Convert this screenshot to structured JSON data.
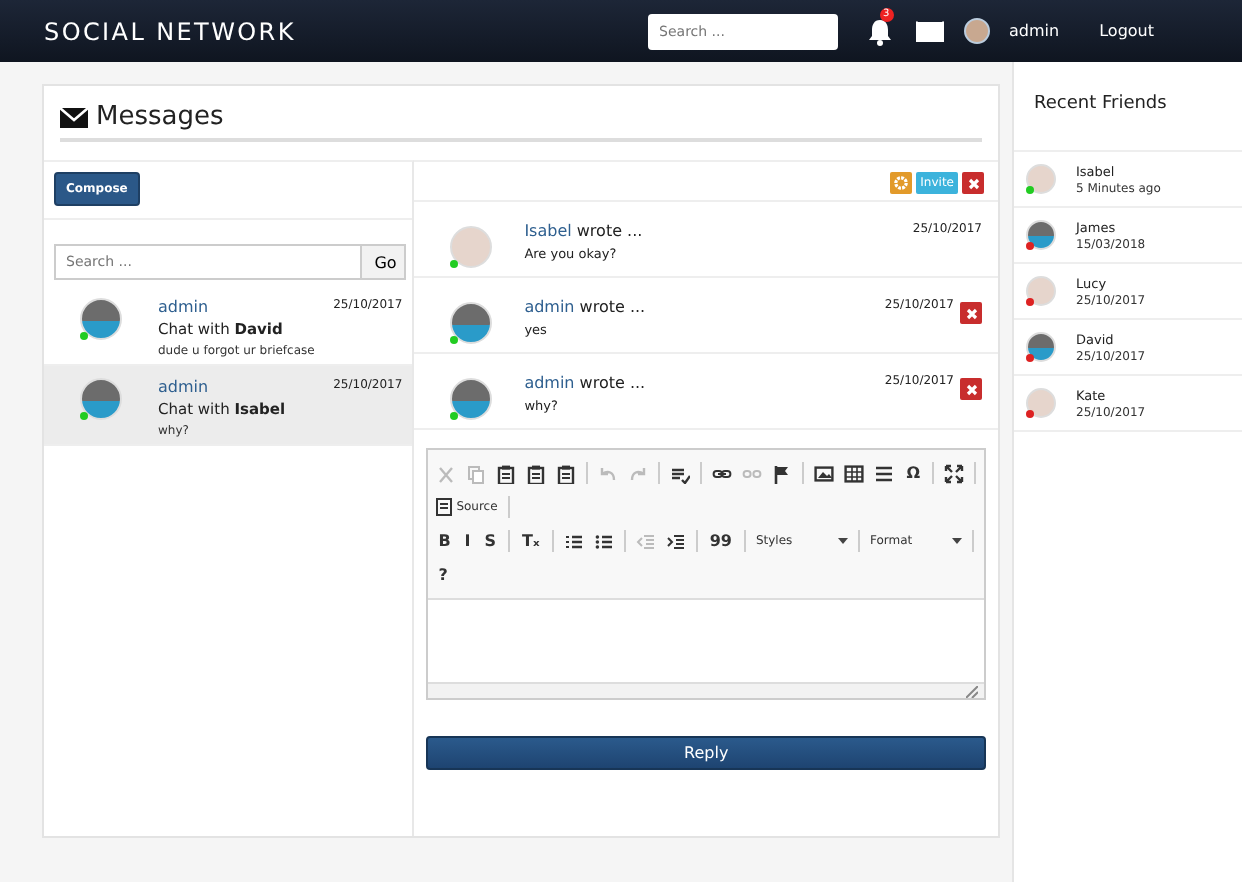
{
  "navbar": {
    "brand": "SOCIAL NETWORK",
    "search": {
      "placeholder": "Search ..."
    },
    "notification_count": "3",
    "user": "admin",
    "logout": "Logout"
  },
  "page_title": "Messages",
  "compose": "Compose",
  "conversation_search": {
    "placeholder": "Search ...",
    "button": "Go"
  },
  "conversations": [
    {
      "author": "admin",
      "title": "Chat with ",
      "partner": "David",
      "date": "25/10/2017",
      "preview": "dude u forgot ur briefcase",
      "online": true,
      "selected": false
    },
    {
      "author": "admin",
      "title": "Chat with ",
      "partner": "Isabel",
      "date": "25/10/2017",
      "preview": "why?",
      "online": true,
      "selected": true
    }
  ],
  "thread_actions": [
    {
      "kind": "settings"
    },
    {
      "kind": "text",
      "label": "Invite"
    },
    {
      "kind": "close"
    }
  ],
  "messages": [
    {
      "author": "Isabel",
      "suffix": "wrote ...",
      "text": "Are you okay?",
      "date": "25/10/2017",
      "online": true,
      "deletable": false
    },
    {
      "author": "admin",
      "suffix": "wrote ...",
      "text": "yes",
      "date": "25/10/2017",
      "online": true,
      "deletable": true
    },
    {
      "author": "admin",
      "suffix": "wrote ...",
      "text": "why?",
      "date": "25/10/2017",
      "online": true,
      "deletable": true
    }
  ],
  "editor": {
    "toolbar_rows": [
      [
        {
          "kind": "icon",
          "disabled": true
        },
        {
          "kind": "icon",
          "disabled": true
        },
        {
          "kind": "icon",
          "disabled": false
        },
        {
          "kind": "icon",
          "disabled": false
        },
        {
          "kind": "icon",
          "disabled": false
        },
        {
          "kind": "sep"
        },
        {
          "kind": "icon",
          "disabled": true
        },
        {
          "kind": "icon",
          "disabled": true
        },
        {
          "kind": "sep"
        },
        {
          "kind": "icon",
          "disabled": false
        },
        {
          "kind": "sep"
        },
        {
          "kind": "icon",
          "disabled": false
        },
        {
          "kind": "icon",
          "disabled": true
        },
        {
          "kind": "icon",
          "disabled": false
        },
        {
          "kind": "sep"
        },
        {
          "kind": "icon",
          "disabled": false
        },
        {
          "kind": "icon",
          "disabled": false
        },
        {
          "kind": "icon",
          "disabled": false
        },
        {
          "kind": "glyph",
          "text": "Ω",
          "disabled": false
        },
        {
          "kind": "sep"
        },
        {
          "kind": "icon",
          "disabled": false
        },
        {
          "kind": "sep"
        }
      ],
      [
        {
          "kind": "source",
          "text": "Source"
        },
        {
          "kind": "sep"
        }
      ],
      [
        {
          "kind": "glyph",
          "text": "B",
          "disabled": false
        },
        {
          "kind": "glyph",
          "text": "I",
          "disabled": false
        },
        {
          "kind": "glyph",
          "text": "S",
          "disabled": false
        },
        {
          "kind": "sep"
        },
        {
          "kind": "glyph",
          "text": "Tₓ",
          "disabled": false
        },
        {
          "kind": "sep"
        },
        {
          "kind": "icon",
          "disabled": false
        },
        {
          "kind": "icon",
          "disabled": false
        },
        {
          "kind": "sep"
        },
        {
          "kind": "icon",
          "disabled": true
        },
        {
          "kind": "icon",
          "disabled": false
        },
        {
          "kind": "sep"
        },
        {
          "kind": "glyph",
          "text": "99",
          "disabled": false
        },
        {
          "kind": "sep"
        },
        {
          "kind": "dropdown",
          "text": "Styles"
        },
        {
          "kind": "sep"
        },
        {
          "kind": "dropdown",
          "text": "Format"
        },
        {
          "kind": "sep"
        }
      ],
      [
        {
          "kind": "glyph",
          "text": "?",
          "disabled": false
        }
      ]
    ]
  },
  "reply": "Reply",
  "recent_friends": {
    "title": "Recent Friends",
    "items": [
      {
        "name": "Isabel",
        "time": "5 Minutes ago",
        "online": true
      },
      {
        "name": "James",
        "time": "15/03/2018",
        "online": false
      },
      {
        "name": "Lucy",
        "time": "25/10/2017",
        "online": false
      },
      {
        "name": "David",
        "time": "25/10/2017",
        "online": false
      },
      {
        "name": "Kate",
        "time": "25/10/2017",
        "online": false
      }
    ]
  }
}
